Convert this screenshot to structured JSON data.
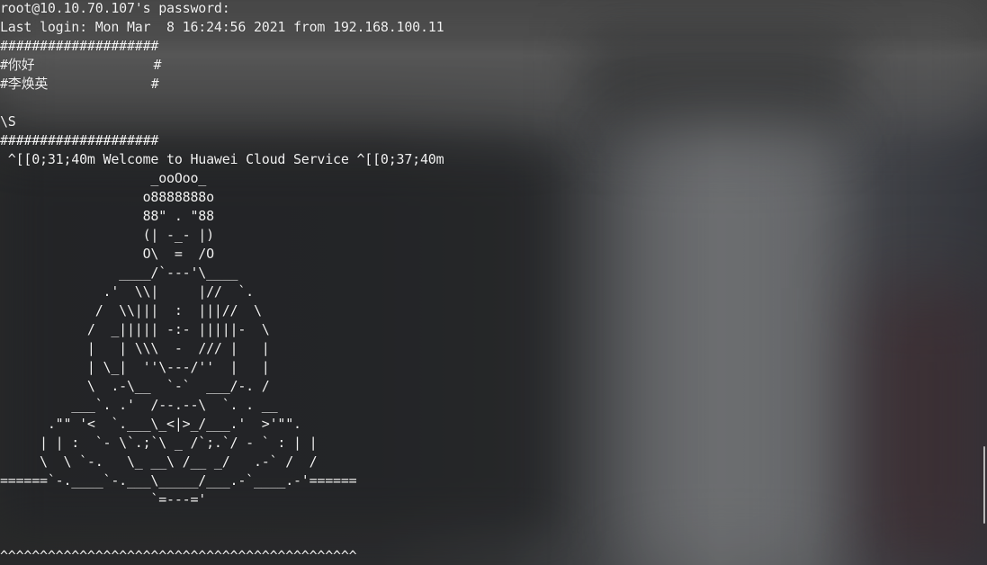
{
  "terminal": {
    "lines": [
      "root@10.10.70.107's password:",
      "Last login: Mon Mar  8 16:24:56 2021 from 192.168.100.11",
      "####################",
      "#你好               #",
      "#李焕英             #",
      "",
      "\\S",
      "####################",
      " ^[[0;31;40m Welcome to Huawei Cloud Service ^[[0;37;40m",
      "                   _ooOoo_",
      "                  o8888888o",
      "                  88\" . \"88",
      "                  (| -_- |)",
      "                  O\\  =  /O",
      "               ____/`---'\\____",
      "             .'  \\\\|     |//  `.",
      "            /  \\\\|||  :  |||//  \\",
      "           /  _||||| -:- |||||-  \\",
      "           |   | \\\\\\  -  /// |   |",
      "           | \\_|  ''\\---/''  |   |",
      "           \\  .-\\__  `-`  ___/-. /",
      "         ___`. .'  /--.--\\  `. . __",
      "      .\"\" '<  `.___\\_<|>_/___.'  >'\"\".",
      "     | | :  `- \\`.;`\\ _ /`;.`/ - ` : | |",
      "     \\  \\ `-.   \\_ __\\ /__ _/   .-` /  /",
      "======`-.____`-.___\\_____/___.-`____.-'======",
      "                   `=---='",
      "",
      "",
      "^^^^^^^^^^^^^^^^^^^^^^^^^^^^^^^^^^^^^^^^^^^^^"
    ]
  },
  "colors": {
    "text": "#f2f2f2",
    "terminal_bg": "#2e2f31",
    "scroll_thumb": "#e6e6e6"
  }
}
